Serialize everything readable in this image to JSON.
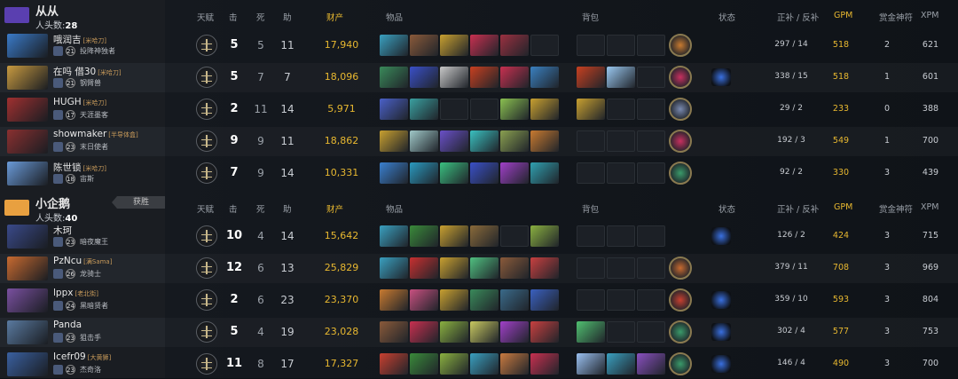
{
  "headers": {
    "talent": "天赋",
    "kills": "击",
    "deaths": "死",
    "assists": "助",
    "networth": "财产",
    "items": "物品",
    "backpack": "背包",
    "status": "状态",
    "lasthits": "正补 / 反补",
    "gpm": "GPM",
    "aghs": "赏金神符",
    "xpm": "XPM"
  },
  "teams": [
    {
      "name": "从从",
      "kills_label": "人头数:",
      "kills": "28",
      "accent": "#5a3fb0",
      "players": [
        {
          "name": "哦润吉",
          "tag": "[米哈刀]",
          "rank": "21",
          "role": "投降神独者",
          "hero_color": "#3a7ac8",
          "k": "5",
          "d": "5",
          "a": "11",
          "nw": "17,940",
          "lh": "297",
          "dn": "14",
          "gpm": "518",
          "aghs": "2",
          "xpm": "621",
          "items": [
            "#3aa0c0",
            "#8a5a3a",
            "#c8a030",
            "#c83050",
            "#9a3040",
            ""
          ],
          "bp": [
            "",
            "",
            ""
          ],
          "neutral": "#c87a30",
          "status": ""
        },
        {
          "name": "在吗 借30",
          "tag": "[米哈刀]",
          "rank": "21",
          "role": "钢臂兽",
          "hero_color": "#c89a40",
          "k": "5",
          "d": "7",
          "a": "7",
          "nw": "18,096",
          "lh": "338",
          "dn": "15",
          "gpm": "518",
          "aghs": "1",
          "xpm": "601",
          "items": [
            "#3a8a5a",
            "#3a50c8",
            "#c8c8c8",
            "#c84020",
            "#c83050",
            "#3a80c0"
          ],
          "bp": [
            "#c84020",
            "#9ac8f0",
            ""
          ],
          "neutral": "#c83060",
          "status": "#3a70e0"
        },
        {
          "name": "HUGH",
          "tag": "[米哈刀]",
          "rank": "17",
          "role": "天涯墨客",
          "hero_color": "#a03030",
          "k": "2",
          "d": "11",
          "a": "14",
          "nw": "5,971",
          "lh": "29",
          "dn": "2",
          "gpm": "233",
          "aghs": "0",
          "xpm": "388",
          "items": [
            "#4a60c8",
            "#3aa0a0",
            "",
            "",
            "#8ac050",
            "#c8a030"
          ],
          "bp": [
            "#c8a030",
            "",
            ""
          ],
          "neutral": "#7a8ab0",
          "status": ""
        },
        {
          "name": "showmaker",
          "tag": "[半导体盒]",
          "rank": "23",
          "role": "末日使者",
          "hero_color": "#8a3030",
          "k": "9",
          "d": "9",
          "a": "11",
          "nw": "18,862",
          "lh": "192",
          "dn": "3",
          "gpm": "549",
          "aghs": "1",
          "xpm": "700",
          "items": [
            "#c8a030",
            "#a0c8c8",
            "#6a50c8",
            "#3ac0c0",
            "#8aa050",
            "#c87a30"
          ],
          "bp": [
            "",
            "",
            ""
          ],
          "neutral": "#c83060",
          "status": ""
        },
        {
          "name": "陈世锁",
          "tag": "[米哈刀]",
          "rank": "18",
          "role": "宙斯",
          "hero_color": "#6a9ad8",
          "k": "7",
          "d": "9",
          "a": "14",
          "nw": "10,331",
          "lh": "92",
          "dn": "2",
          "gpm": "330",
          "aghs": "3",
          "xpm": "439",
          "items": [
            "#3a80d0",
            "#2a9ac0",
            "#3ac080",
            "#3a50c8",
            "#a040c8",
            "#30a0b0"
          ],
          "bp": [
            "",
            "",
            ""
          ],
          "neutral": "#3a9a6a",
          "status": ""
        }
      ]
    },
    {
      "name": "小企鹅",
      "kills_label": "人头数:",
      "kills": "40",
      "accent": "#e8a040",
      "result": "获胜",
      "players": [
        {
          "name": "木珂",
          "tag": "",
          "rank": "23",
          "role": "暗夜魔王",
          "hero_color": "#3a4a8a",
          "k": "10",
          "d": "4",
          "a": "14",
          "nw": "15,642",
          "lh": "126",
          "dn": "2",
          "gpm": "424",
          "aghs": "3",
          "xpm": "715",
          "items": [
            "#3aa0c0",
            "#3a8a3a",
            "#c8a030",
            "#8a6a3a",
            "",
            "#8ab040"
          ],
          "bp": [
            "",
            "",
            ""
          ],
          "neutral": "",
          "status": "#3a70e0"
        },
        {
          "name": "PzNcu",
          "tag": "[满Sama]",
          "rank": "26",
          "role": "龙骑士",
          "hero_color": "#c86a30",
          "k": "12",
          "d": "6",
          "a": "13",
          "nw": "25,829",
          "lh": "379",
          "dn": "11",
          "gpm": "708",
          "aghs": "3",
          "xpm": "969",
          "items": [
            "#3aa0c0",
            "#c83030",
            "#c8a030",
            "#50c080",
            "#8a5a3a",
            "#c84040"
          ],
          "bp": [
            "",
            "",
            ""
          ],
          "neutral": "#c86a30",
          "status": ""
        },
        {
          "name": "lppx",
          "tag": "[老北街]",
          "rank": "24",
          "role": "黑暗贤者",
          "hero_color": "#7a50a0",
          "k": "2",
          "d": "6",
          "a": "23",
          "nw": "23,370",
          "lh": "359",
          "dn": "10",
          "gpm": "593",
          "aghs": "3",
          "xpm": "804",
          "items": [
            "#c87a30",
            "#c85080",
            "#c8a030",
            "#3a8a5a",
            "#3a6a8a",
            "#3a60c0"
          ],
          "bp": [
            "",
            "",
            ""
          ],
          "neutral": "#c84030",
          "status": "#3a70e0"
        },
        {
          "name": "Panda",
          "tag": "",
          "rank": "23",
          "role": "狙击手",
          "hero_color": "#5a7aa0",
          "k": "5",
          "d": "4",
          "a": "19",
          "nw": "23,028",
          "lh": "302",
          "dn": "4",
          "gpm": "577",
          "aghs": "3",
          "xpm": "753",
          "items": [
            "#8a5a3a",
            "#c83050",
            "#8ab040",
            "#c8c860",
            "#a040c8",
            "#c84040"
          ],
          "bp": [
            "#50c070",
            "",
            ""
          ],
          "neutral": "#3a9a6a",
          "status": "#3a70e0"
        },
        {
          "name": "Icefr09",
          "tag": "[大黄狮]",
          "rank": "23",
          "role": "杰奇洛",
          "hero_color": "#3a60a0",
          "k": "11",
          "d": "8",
          "a": "17",
          "nw": "17,327",
          "lh": "146",
          "dn": "4",
          "gpm": "490",
          "aghs": "3",
          "xpm": "700",
          "items": [
            "#c84030",
            "#3a8a3a",
            "#8ab040",
            "#3aa0c0",
            "#c87a40",
            "#c83050"
          ],
          "bp": [
            "#9ac0f0",
            "#3aa0c0",
            "#8a50c0"
          ],
          "neutral": "#3a9a6a",
          "status": "#3a70e0"
        }
      ]
    }
  ]
}
